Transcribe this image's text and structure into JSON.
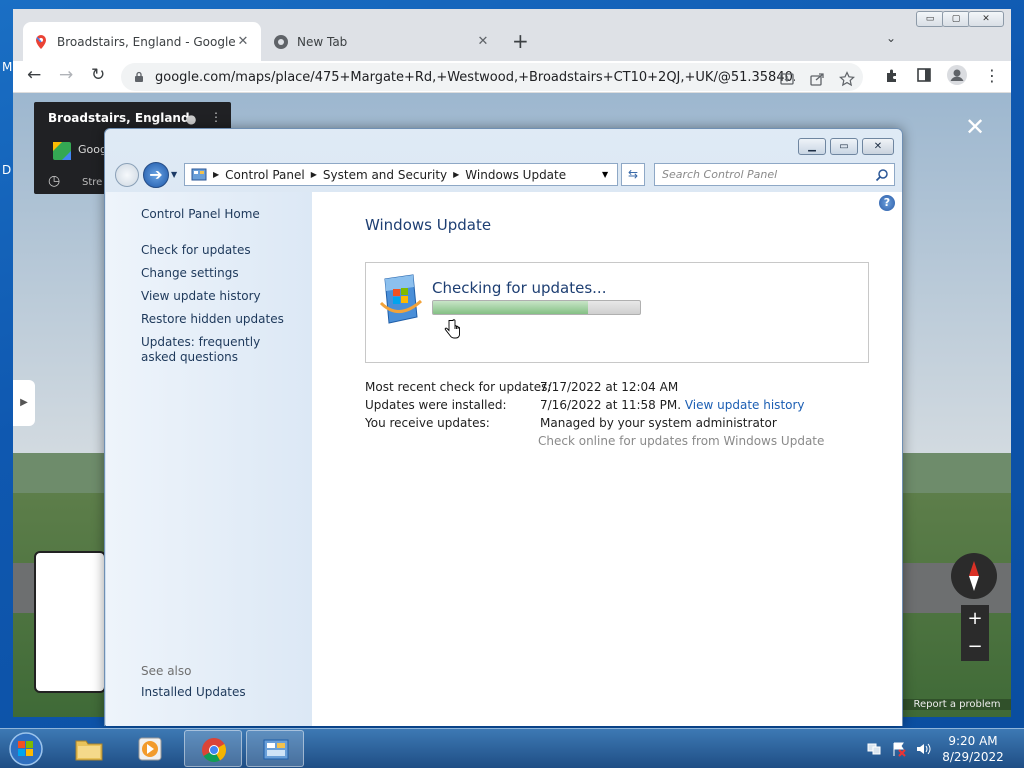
{
  "desktop": {
    "left_fragments": [
      "M",
      "D"
    ]
  },
  "browser": {
    "tabs": [
      {
        "title": "Broadstairs, England - Google Maps",
        "active": true
      },
      {
        "title": "New Tab",
        "active": false
      }
    ],
    "url": "google.com/maps/place/475+Margate+Rd,+Westwood,+Broadstairs+CT10+2QJ,+UK/@51.35840...",
    "window_buttons": {
      "min": "▭",
      "restore": "▢",
      "close": "✕"
    }
  },
  "maps": {
    "place_title": "Broadstairs, England",
    "brand_fragment": "Goog",
    "street_fragment": "Stre",
    "report": "Report a problem"
  },
  "control_panel": {
    "breadcrumb": [
      "Control Panel",
      "System and Security",
      "Windows Update"
    ],
    "search_placeholder": "Search Control Panel",
    "left_links": [
      "Control Panel Home",
      "Check for updates",
      "Change settings",
      "View update history",
      "Restore hidden updates",
      "Updates: frequently asked questions"
    ],
    "see_also_label": "See also",
    "see_also_links": [
      "Installed Updates"
    ],
    "heading": "Windows Update",
    "status_text": "Checking for updates...",
    "progress": 0.75,
    "info": [
      {
        "label": "Most recent check for updates:",
        "value": "7/17/2022 at 12:04 AM"
      },
      {
        "label": "Updates were installed:",
        "value": "7/16/2022 at 11:58 PM.",
        "link": "View update history"
      },
      {
        "label": "You receive updates:",
        "value": "Managed by your system administrator"
      }
    ],
    "check_online": "Check online for updates from Windows Update"
  },
  "taskbar": {
    "time": "9:20 AM",
    "date": "8/29/2022"
  },
  "colors": {
    "link": "#1b5eb3",
    "heading": "#1e3f73",
    "progress_green": "#5cb85c"
  }
}
